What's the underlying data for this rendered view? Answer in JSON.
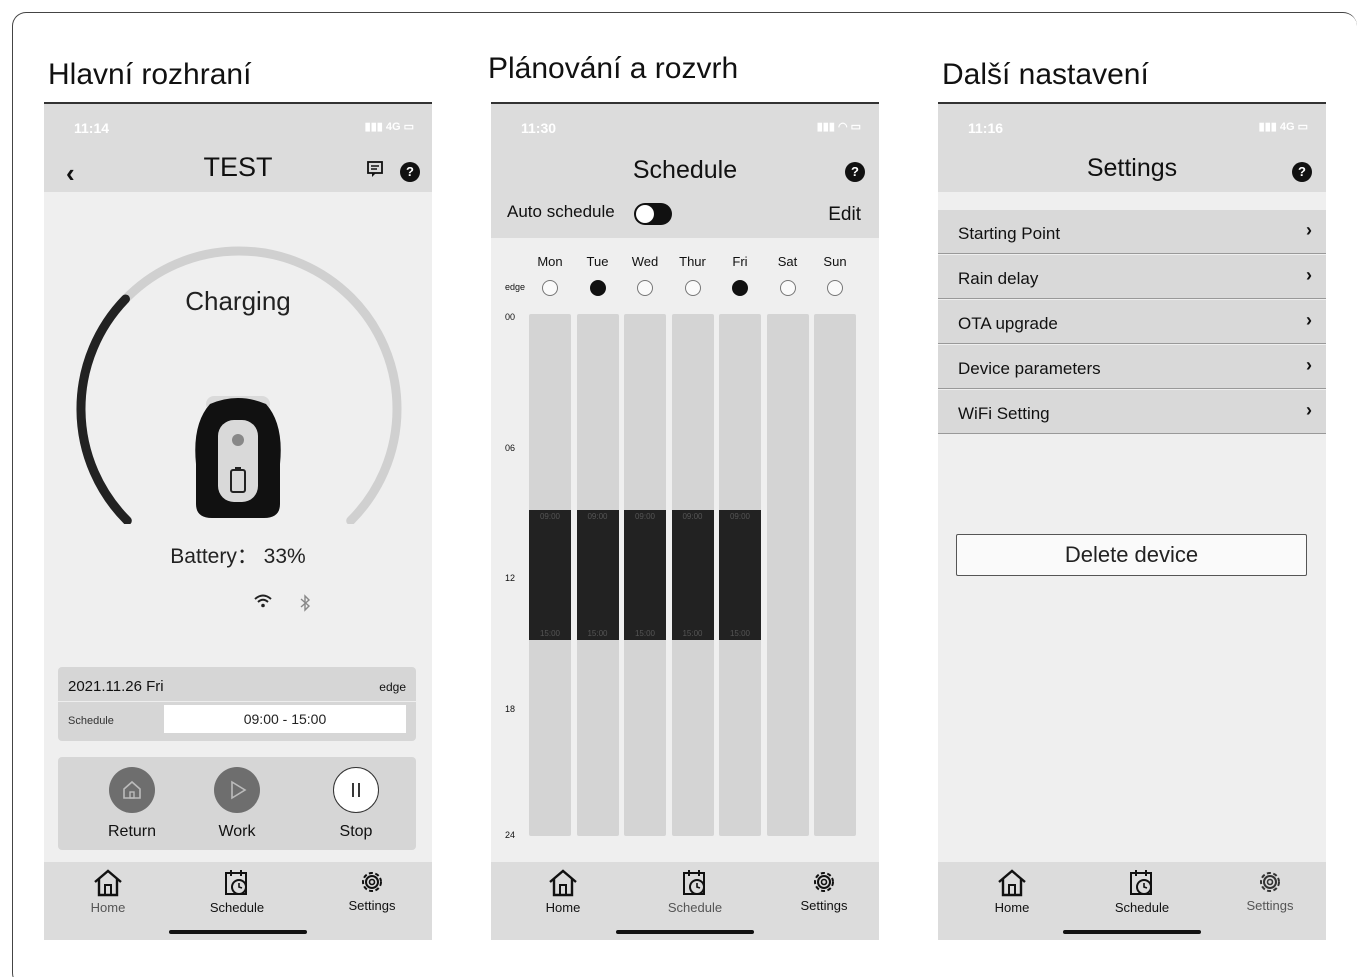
{
  "captions": [
    "Hlavní rozhraní",
    "Plánování a rozvrh",
    "Další nastavení"
  ],
  "tabs": {
    "home": "Home",
    "schedule": "Schedule",
    "settings": "Settings"
  },
  "main": {
    "time": "11:14",
    "signal": "4G",
    "title": "TEST",
    "status": "Charging",
    "battery": "Battery： 33%",
    "battery_level": 0.33,
    "date": "2021.11.26 Fri",
    "tag": "edge",
    "schedule_label": "Schedule",
    "schedule_value": "09:00 - 15:00",
    "controls": [
      "Return",
      "Work",
      "Stop"
    ]
  },
  "schedule": {
    "time": "11:30",
    "title": "Schedule",
    "auto_label": "Auto schedule",
    "edit_label": "Edit",
    "edge_label": "edge",
    "days": [
      "Mon",
      "Tue",
      "Wed",
      "Thur",
      "Fri",
      "Sat",
      "Sun"
    ],
    "edge_selected": [
      false,
      true,
      false,
      false,
      true,
      false,
      false
    ],
    "hours": [
      "00",
      "06",
      "12",
      "18",
      "24"
    ],
    "slot_start": "09:00",
    "slot_end": "15:00",
    "slot_start_hour": 9,
    "slot_end_hour": 15,
    "slot_days": [
      true,
      true,
      true,
      true,
      true,
      false,
      false
    ]
  },
  "settings": {
    "time": "11:16",
    "signal": "4G",
    "title": "Settings",
    "menu": [
      "Starting Point",
      "Rain delay",
      "OTA upgrade",
      "Device parameters",
      "WiFi Setting"
    ],
    "delete_label": "Delete device"
  },
  "colors": {
    "bar": "#dcdcdc",
    "body": "#efefef",
    "slot": "#222222",
    "gauge_track": "#d0d0d0",
    "gauge_fill": "#222222"
  }
}
